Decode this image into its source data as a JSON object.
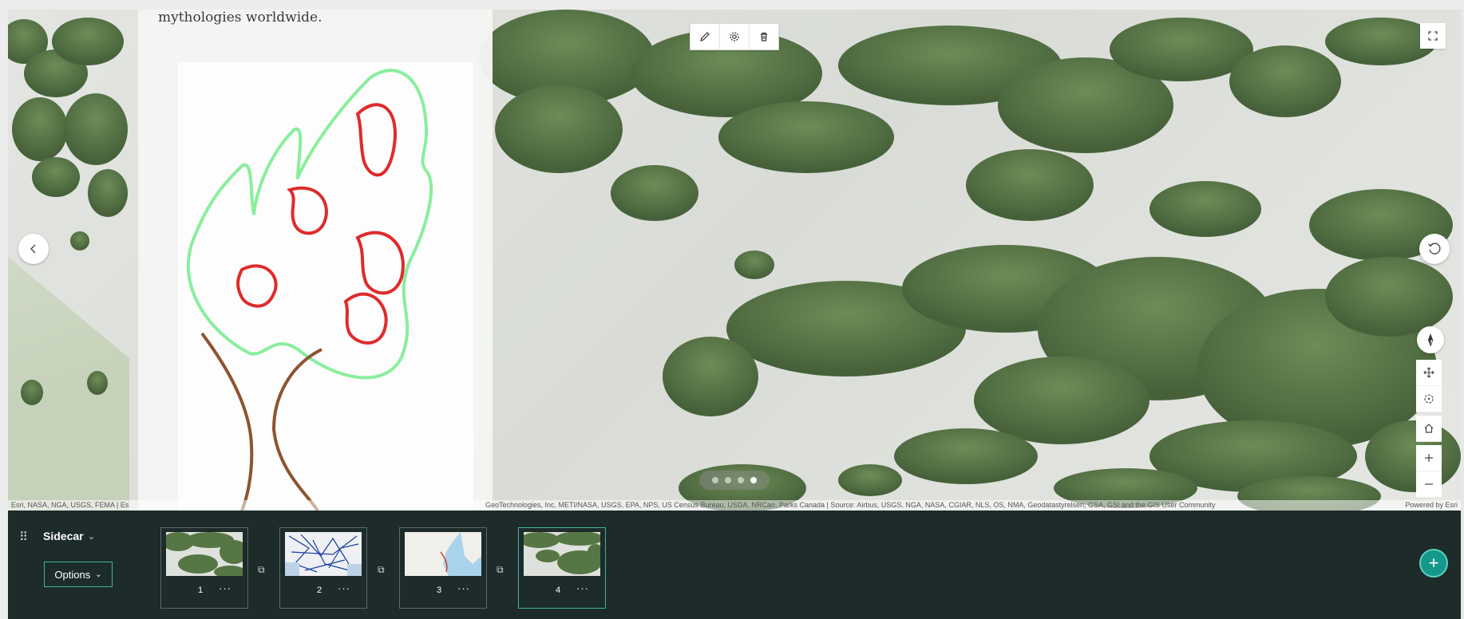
{
  "panel": {
    "text": "mythologies worldwide."
  },
  "map": {
    "attribution_left": "Esri, NASA, NGA, USGS, FEMA | Es",
    "attribution_mid": "GeoTechnologies, Inc, METI/NASA, USGS, EPA, NPS, US Census Bureau, USDA, NRCan, Parks Canada | Source: Airbus, USGS, NGA, NASA, CGIAR, NLS, OS, NMA, Geodatastyrelsen, GSA, GSI and the GIS User Community",
    "attribution_right": "Powered by Esri",
    "edit_toolbar": [
      "pencil-icon",
      "gear-icon",
      "trash-icon"
    ],
    "pager_dots": 4,
    "active_dot": 4
  },
  "builder": {
    "title": "Sidecar",
    "options_label": "Options",
    "slides": [
      {
        "number": "1",
        "thumb": "forest"
      },
      {
        "number": "2",
        "thumb": "map-dense"
      },
      {
        "number": "3",
        "thumb": "map-route"
      },
      {
        "number": "4",
        "thumb": "forest",
        "active": true
      }
    ],
    "more_label": "···",
    "add_label": "+"
  },
  "colors": {
    "builder_bg": "#1d2b2a",
    "accent": "#3fb3a3",
    "add_button": "#159889",
    "tree_green": "#567544"
  }
}
